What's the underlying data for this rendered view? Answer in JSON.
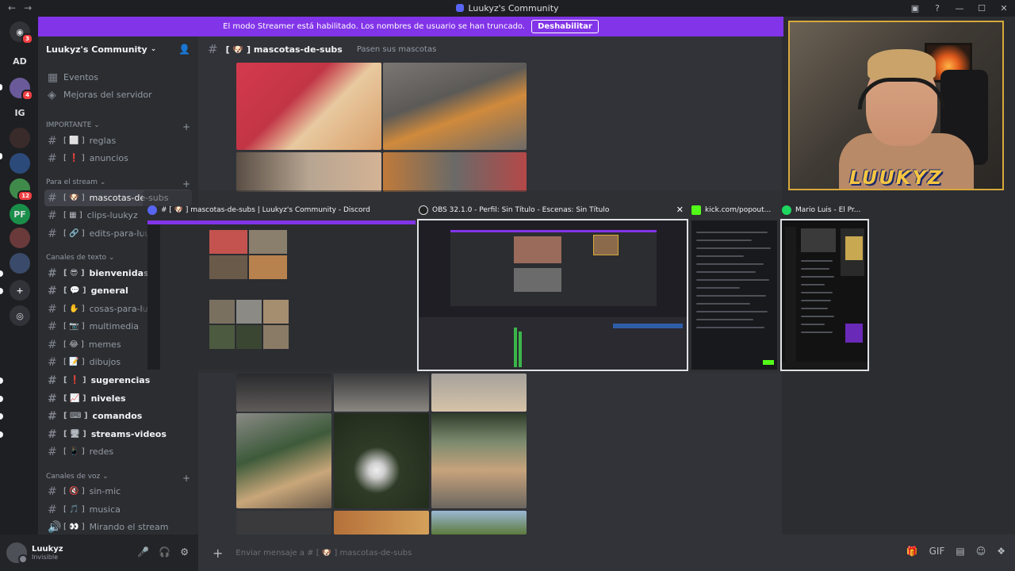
{
  "window": {
    "title": "Luukyz's Community",
    "back_icon": "←",
    "forward_icon": "→",
    "win_buttons": [
      "▣",
      "?",
      "—",
      "☐",
      "✕"
    ]
  },
  "banner": {
    "text": "El modo Streamer está habilitado. Los nombres de usuario se han truncado.",
    "button": "Deshabilitar"
  },
  "servers": [
    {
      "label": "◉",
      "badge": "3",
      "color": "#313338"
    },
    {
      "label": "AD",
      "badge": "",
      "color": "#1e1f22"
    },
    {
      "label": "",
      "badge": "4",
      "color": "#6b5a9a"
    },
    {
      "label": "IG",
      "badge": "",
      "color": "#1e1f22"
    },
    {
      "label": "",
      "badge": "",
      "color": "#3a2b2b"
    },
    {
      "label": "",
      "badge": "",
      "color": "#2b4a7a"
    },
    {
      "label": "",
      "badge": "12",
      "color": "#3f8a4a"
    },
    {
      "label": "PF",
      "badge": "",
      "color": "#1a8f4a"
    },
    {
      "label": "",
      "badge": "",
      "color": "#6a3a3a"
    },
    {
      "label": "",
      "badge": "",
      "color": "#3a4a6a"
    },
    {
      "label": "+",
      "badge": "",
      "color": "#313338"
    },
    {
      "label": "◎",
      "badge": "",
      "color": "#313338"
    }
  ],
  "guild": {
    "name": "Luukyz's Community",
    "chevron": "⌄",
    "invite_icon": "👤"
  },
  "sidebar": {
    "top_items": [
      {
        "icon": "▦",
        "label": "Eventos"
      },
      {
        "icon": "◈",
        "label": "Mejoras del servidor"
      }
    ],
    "categories": {
      "importante": "IMPORTANTE ⌄",
      "stream": "Para el stream ⌄",
      "texto": "Canales de texto ⌄",
      "voz": "Canales de voz ⌄"
    },
    "plus": "+",
    "channels": [
      {
        "emoji": "[ ⬜ ]",
        "label": "reglas"
      },
      {
        "emoji": "[ ❗ ]",
        "label": "anuncios"
      },
      {
        "emoji": "[ 🐶 ]",
        "label": "mascotas-de-subs"
      },
      {
        "emoji": "[ ▦ ]",
        "label": "clips-luukyz"
      },
      {
        "emoji": "[ 🔗 ]",
        "label": "edits-para-luukyz"
      },
      {
        "emoji": "[ 😎 ]",
        "label": "bienvenidas"
      },
      {
        "emoji": "[ 💬 ]",
        "label": "general"
      },
      {
        "emoji": "[ ✋ ]",
        "label": "cosas-para-luukyz"
      },
      {
        "emoji": "[ 📷 ]",
        "label": "multimedia"
      },
      {
        "emoji": "[ 😂 ]",
        "label": "memes"
      },
      {
        "emoji": "[ 📝 ]",
        "label": "dibujos"
      },
      {
        "emoji": "[ ❗ ]",
        "label": "sugerencias"
      },
      {
        "emoji": "[ 📈 ]",
        "label": "niveles"
      },
      {
        "emoji": "[ ⌨ ]",
        "label": "comandos"
      },
      {
        "emoji": "[ 🖥 ]",
        "label": "streams-videos"
      },
      {
        "emoji": "[ 📱 ]",
        "label": "redes"
      },
      {
        "emoji": "[ 🔇 ]",
        "label": "sin-mic"
      },
      {
        "emoji": "[ 🎵 ]",
        "label": "musica"
      },
      {
        "emoji": "[ 👀 ]",
        "label": "Mirando el stream"
      }
    ],
    "hash": "#",
    "speaker": "🔊"
  },
  "user": {
    "name": "Luukyz",
    "status": "Invisible",
    "icons": [
      "🎤",
      "🎧",
      "⚙"
    ]
  },
  "channel_header": {
    "hash": "#",
    "name": "[ 🐶 ]  mascotas-de-subs",
    "topic": "Pasen sus mascotas"
  },
  "composer": {
    "plus": "+",
    "placeholder": "Enviar mensaje a # [ 🐶 ]  mascotas-de-subs",
    "tools": [
      "🎁",
      "GIF",
      "▤",
      "☺",
      "❖"
    ]
  },
  "webcam": {
    "label": "LUUKYZ"
  },
  "alt_tab": {
    "windows": [
      {
        "caption": "# [ 🐶 ] mascotas-de-subs | Luukyz's Community - Discord",
        "icon_color": "#5865f2"
      },
      {
        "caption": "OBS 32.1.0 - Perfil: Sin Título - Escenas: Sin Título",
        "icon_color": "#222222",
        "close": "✕"
      },
      {
        "caption": "kick.com/popout...",
        "icon_color": "#53fc18"
      },
      {
        "caption": "Mario Luis - El Pr...",
        "icon_color": "#1ed760"
      }
    ]
  },
  "colors": {
    "accent": "#5865f2",
    "streamer_banner": "#8234e8",
    "webcam_border": "#d7a93b"
  }
}
